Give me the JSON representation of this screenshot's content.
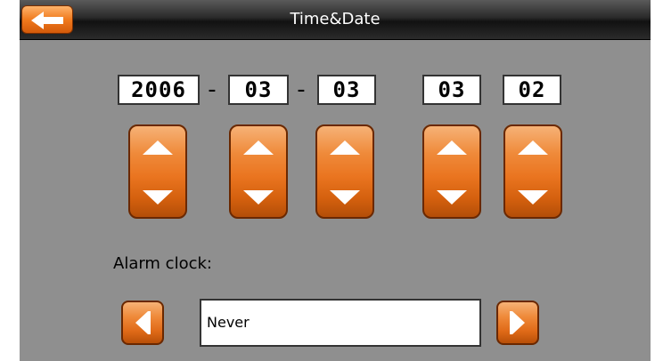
{
  "header": {
    "title": "Time&Date",
    "back_icon": "arrow-left-icon"
  },
  "date": {
    "year": "2006",
    "month": "03",
    "day": "03",
    "separator": "-"
  },
  "time": {
    "hour": "03",
    "minute": "02"
  },
  "alarm": {
    "label": "Alarm clock:",
    "value": "Never",
    "prev_icon": "triangle-left-icon",
    "next_icon": "triangle-right-icon"
  },
  "colors": {
    "accent": "#ef7a22",
    "background": "#8f8f8f",
    "titlebar": "#222222"
  }
}
